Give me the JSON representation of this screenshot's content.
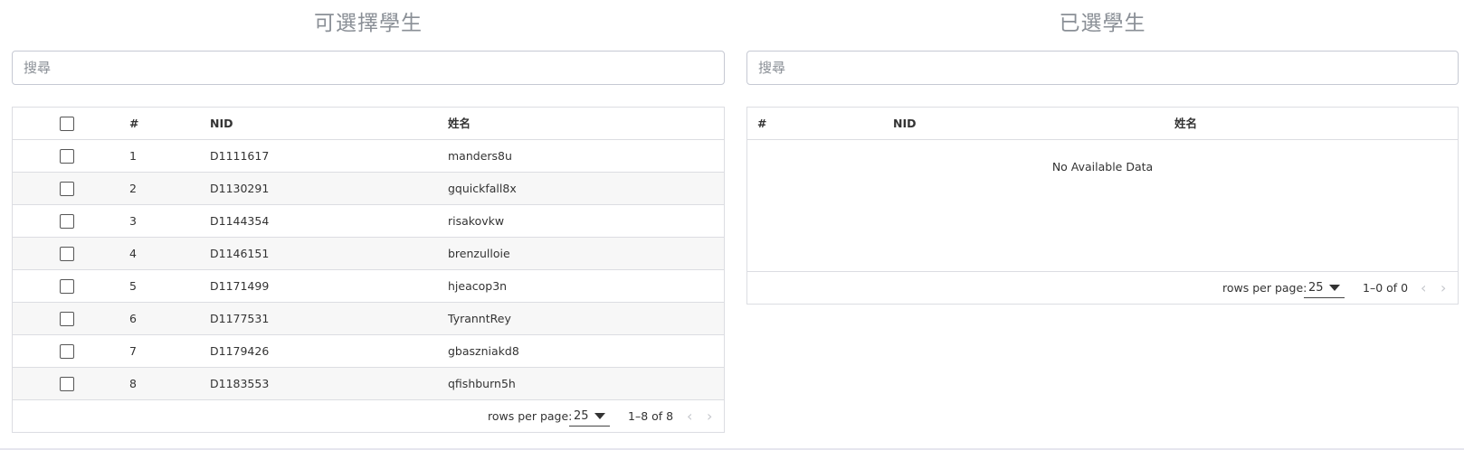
{
  "available": {
    "title": "可選擇學生",
    "search_placeholder": "搜尋",
    "columns": {
      "index": "#",
      "nid": "NID",
      "name": "姓名"
    },
    "rows": [
      {
        "index": "1",
        "nid": "D1111617",
        "name": "manders8u"
      },
      {
        "index": "2",
        "nid": "D1130291",
        "name": "gquickfall8x"
      },
      {
        "index": "3",
        "nid": "D1144354",
        "name": "risakovkw"
      },
      {
        "index": "4",
        "nid": "D1146151",
        "name": "brenzulloie"
      },
      {
        "index": "5",
        "nid": "D1171499",
        "name": "hjeacop3n"
      },
      {
        "index": "6",
        "nid": "D1177531",
        "name": "TyranntRey"
      },
      {
        "index": "7",
        "nid": "D1179426",
        "name": "gbaszniakd8"
      },
      {
        "index": "8",
        "nid": "D1183553",
        "name": "qfishburn5h"
      }
    ],
    "footer": {
      "rows_per_page_label": "rows per page:",
      "rows_per_page": "25",
      "range": "1–8 of 8"
    }
  },
  "selected": {
    "title": "已選學生",
    "search_placeholder": "搜尋",
    "columns": {
      "index": "#",
      "nid": "NID",
      "name": "姓名"
    },
    "empty_text": "No Available Data",
    "footer": {
      "rows_per_page_label": "rows per page:",
      "rows_per_page": "25",
      "range": "1–0 of 0"
    }
  },
  "icons": {
    "prev": "chevron-left-icon",
    "next": "chevron-right-icon",
    "dropdown": "caret-down-icon"
  }
}
